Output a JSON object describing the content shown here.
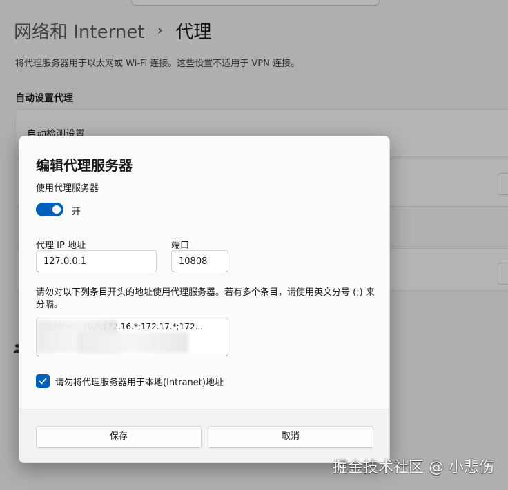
{
  "page": {
    "breadcrumb_parent": "网络和 Internet",
    "breadcrumb_separator": "›",
    "breadcrumb_current": "代理",
    "description": "将代理服务器用于以太网或 Wi-Fi 连接。这些设置不适用于 VPN 连接。",
    "auto_section_title": "自动设置代理",
    "auto_detect_label": "自动检测设置"
  },
  "dialog": {
    "title": "编辑代理服务器",
    "use_proxy_label": "使用代理服务器",
    "toggle_state": "开",
    "ip_label": "代理 IP 地址",
    "ip_value": "127.0.0.1",
    "port_label": "端口",
    "port_value": "10808",
    "exceptions_desc": "请勿对以下列条目开头的地址使用代理服务器。若有多个条目，请使用英文分号 (;) 来分隔。",
    "exceptions_value": "localhost;10.*;172.16.*;172.17.*;172...",
    "bypass_local_label": "请勿将代理服务器用于本地(Intranet)地址",
    "save_label": "保存",
    "cancel_label": "取消"
  },
  "watermark": "掘金技术社区 @ 小悲伤",
  "colors": {
    "accent": "#005fb8",
    "page_bg": "#f3f3f3",
    "dialog_bg": "#fbfbfb"
  }
}
